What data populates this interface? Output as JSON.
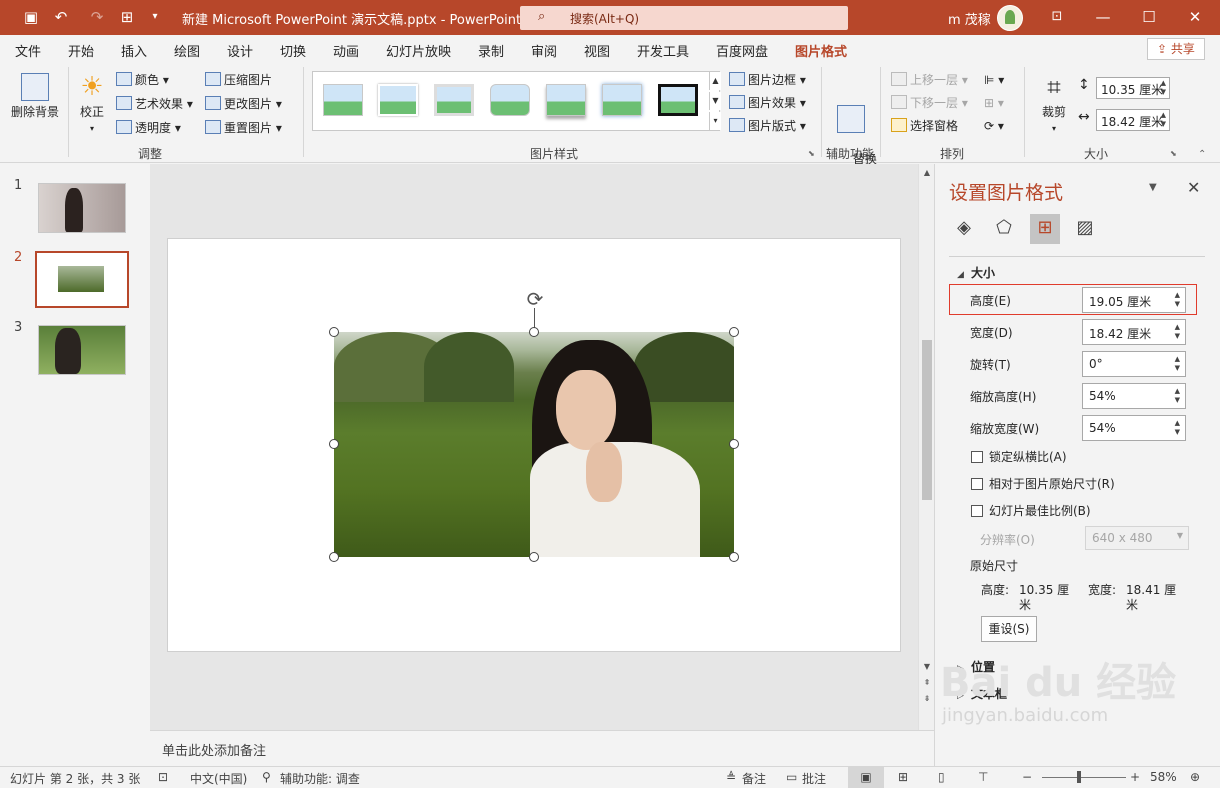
{
  "titlebar": {
    "doc_title": "新建 Microsoft PowerPoint 演示文稿.pptx  -  PowerPoint",
    "search_icon": "search-icon",
    "search_label": "搜索(Alt+Q)",
    "user_name": "m 茂稼",
    "accent": "#b7472a"
  },
  "tabs": [
    "文件",
    "开始",
    "插入",
    "绘图",
    "设计",
    "切换",
    "动画",
    "幻灯片放映",
    "录制",
    "审阅",
    "视图",
    "开发工具",
    "百度网盘",
    "图片格式"
  ],
  "active_tab": "图片格式",
  "share_label": "共享",
  "ribbon": {
    "remove_bg": "删除背景",
    "corrections": "校正",
    "color": "颜色",
    "artistic": "艺术效果",
    "transparency": "透明度",
    "compress": "压缩图片",
    "change": "更改图片",
    "reset": "重置图片",
    "group_adjust": "调整",
    "group_styles": "图片样式",
    "border": "图片边框",
    "effects": "图片效果",
    "layout": "图片版式",
    "alt_text": "替换\n文字",
    "group_access": "辅助功能",
    "bring_forward": "上移一层",
    "send_backward": "下移一层",
    "selection_pane": "选择窗格",
    "group_arrange": "排列",
    "crop": "裁剪",
    "height_val": "10.35 厘米",
    "width_val": "18.42 厘米",
    "group_size": "大小"
  },
  "slides": [
    "1",
    "2",
    "3"
  ],
  "selected_slide": 2,
  "notes_placeholder": "单击此处添加备注",
  "format_pane": {
    "title": "设置图片格式",
    "section_size": "大小",
    "height_label": "高度(E)",
    "height_value": "19.05 厘米",
    "width_label": "宽度(D)",
    "width_value": "18.42 厘米",
    "rotation_label": "旋转(T)",
    "rotation_value": "0°",
    "scale_h_label": "缩放高度(H)",
    "scale_h_value": "54%",
    "scale_w_label": "缩放宽度(W)",
    "scale_w_value": "54%",
    "lock_aspect": "锁定纵横比(A)",
    "relative_original": "相对于图片原始尺寸(R)",
    "best_scale": "幻灯片最佳比例(B)",
    "resolution_label": "分辨率(O)",
    "resolution_value": "640 x 480",
    "original_size": "原始尺寸",
    "orig_h_label": "高度:",
    "orig_h_value": "10.35 厘",
    "orig_h_unit": "米",
    "orig_w_label": "宽度:",
    "orig_w_value": "18.41 厘",
    "orig_w_unit": "米",
    "reset_btn": "重设(S)",
    "section_position": "位置",
    "section_textbox": "文本框"
  },
  "status": {
    "slide_info": "幻灯片 第 2 张，共 3 张",
    "language": "中文(中国)",
    "accessibility": "辅助功能: 调查",
    "notes": "备注",
    "comments": "批注",
    "zoom": "58%"
  },
  "watermark": {
    "brand": "Bai  du 经验",
    "url": "jingyan.baidu.com"
  }
}
